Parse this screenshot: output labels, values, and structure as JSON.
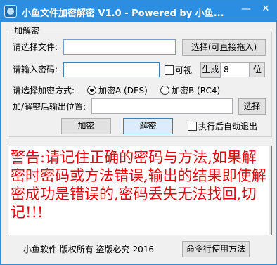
{
  "window": {
    "title": "小鱼文件加密解密 V1.0 - Powered by 小鱼...",
    "minimize_glyph": "—",
    "close_glyph": "✕"
  },
  "group": {
    "title": "加解密"
  },
  "file_row": {
    "label": "请选择文件:",
    "value": "",
    "browse_button": "选择(可直接拖入)"
  },
  "password_row": {
    "label": "请输入密码:",
    "value": "",
    "show_checkbox_label": "可视",
    "show_checked": false,
    "generate_button": "生成",
    "length_value": "8",
    "unit_button": "位"
  },
  "method_row": {
    "label": "请选择加密方式:",
    "options": [
      {
        "label": "加密A (DES)",
        "checked": true
      },
      {
        "label": "加密B (RC4)",
        "checked": false
      }
    ]
  },
  "output_row": {
    "label": "加/解密后输出位置:",
    "value": "",
    "browse_button": "选择"
  },
  "actions": {
    "encrypt_button": "加密",
    "decrypt_button": "解密",
    "auto_exit_label": "执行后自动退出",
    "auto_exit_checked": false
  },
  "warning": {
    "text": "警告:请记住正确的密码与方法,如果解密时密码或方法错误,输出的结果即使解密成功是错误的,密码丢失无法找回,切记!!!",
    "color": "#e8000b"
  },
  "footer": {
    "copyright": "小鱼软件 版权所有 盗版必究 2016",
    "help_button": "命令行使用方法"
  },
  "colors": {
    "titlebar": "#2b8ee0",
    "window_bg": "#f0f0f0"
  },
  "icons": {
    "app": "app-icon",
    "minimize": "minimize-icon",
    "close": "close-icon"
  }
}
